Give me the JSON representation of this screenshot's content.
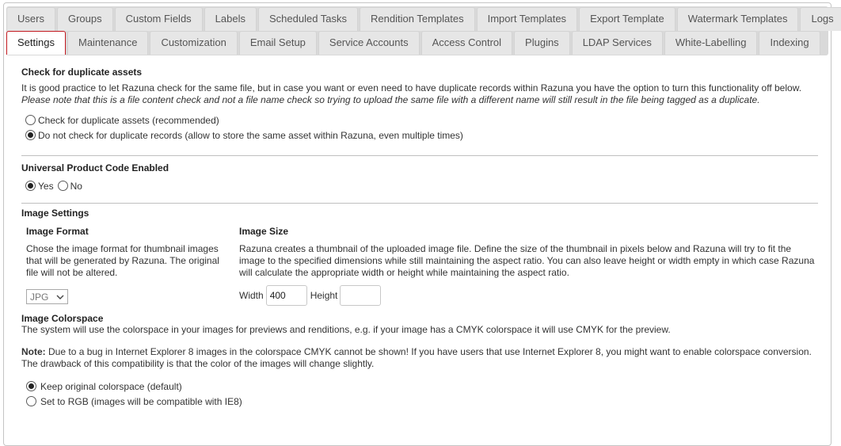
{
  "tabs_row1": [
    "Users",
    "Groups",
    "Custom Fields",
    "Labels",
    "Scheduled Tasks",
    "Rendition Templates",
    "Import Templates",
    "Export Template",
    "Watermark Templates",
    "Logs"
  ],
  "tabs_row2": [
    "Settings",
    "Maintenance",
    "Customization",
    "Email Setup",
    "Service Accounts",
    "Access Control",
    "Plugins",
    "LDAP Services",
    "White-Labelling",
    "Indexing"
  ],
  "active_tab": "Settings",
  "duplicates": {
    "title": "Check for duplicate assets",
    "text": "It is good practice to let Razuna check for the same file, but in case you want or even need to have duplicate records within Razuna you have the option to turn this functionality off below.",
    "note": "Please note that this is a file content check and not a file name check so trying to upload the same file with a different name will still result in the file being tagged as a duplicate.",
    "option_check": "Check for duplicate assets (recommended)",
    "option_no_check": "Do not check for duplicate records (allow to store the same asset within Razuna, even multiple times)",
    "selected": "no_check"
  },
  "upc": {
    "title": "Universal Product Code Enabled",
    "yes_label": "Yes",
    "no_label": "No",
    "selected": "yes"
  },
  "image_settings": {
    "title": "Image Settings",
    "format_title": "Image Format",
    "format_text": "Chose the image format for thumbnail images that will be generated by Razuna. The original file will not be altered.",
    "format_value": "JPG",
    "size_title": "Image Size",
    "size_text": "Razuna creates a thumbnail of the uploaded image file. Define the size of the thumbnail in pixels below and Razuna will try to fit the image to the specified dimensions while still maintaining the aspect ratio. You can also leave height or width empty in which case Razuna will calculate the appropriate width or height while maintaining the aspect ratio.",
    "width_label": "Width",
    "width_value": "400",
    "height_label": "Height",
    "height_value": ""
  },
  "colorspace": {
    "title": "Image Colorspace",
    "text": "The system will use the colorspace in your images for previews and renditions, e.g. if your image has a CMYK colorspace it will use CMYK for the preview.",
    "note_label": "Note:",
    "note_text": " Due to a bug in Internet Explorer 8 images in the colorspace CMYK cannot be shown! If you have users that use Internet Explorer 8, you might want to enable colorspace conversion. The drawback of this compatibility is that the color of the images will change slightly.",
    "option_keep": "Keep original colorspace (default)",
    "option_rgb": "Set to RGB (images will be compatible with IE8)",
    "selected": "keep"
  },
  "colors": {
    "active_tab_border": "#c2181e",
    "tab_bg": "#e6e6e6",
    "tabbar_bg": "#d9d9d9"
  }
}
